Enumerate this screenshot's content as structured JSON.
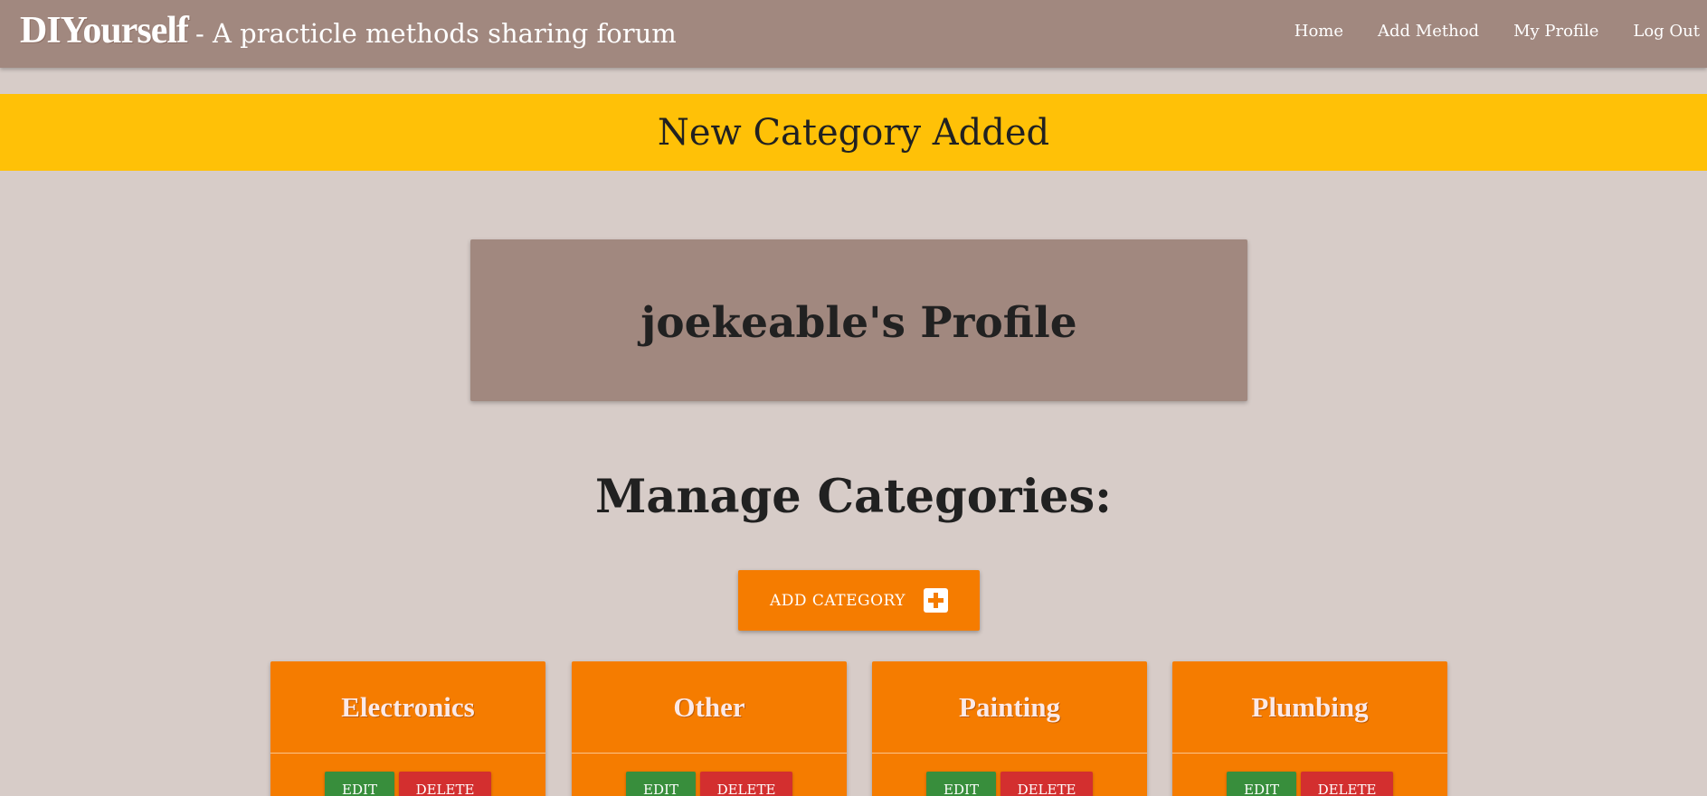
{
  "navbar": {
    "brand": "DIYourself",
    "tagline": "- A practicle methods sharing forum",
    "links": [
      "Home",
      "Add Method",
      "My Profile",
      "Log Out"
    ]
  },
  "alert": {
    "message": "New Category Added"
  },
  "profile": {
    "title": "joekeable's Profile"
  },
  "categories_section": {
    "title": "Manage Categories:",
    "add_button_label": "ADD CATEGORY",
    "add_button_icon": "plus-square-icon",
    "edit_label": "EDIT",
    "delete_label": "DELETE",
    "items": [
      "Electronics",
      "Other",
      "Painting",
      "Plumbing"
    ]
  },
  "colors": {
    "navbar": "#a1887f",
    "background": "#d7ccc8",
    "alert": "#ffc107",
    "card": "#f57c00",
    "edit": "#388e3c",
    "delete": "#d32f2f"
  }
}
